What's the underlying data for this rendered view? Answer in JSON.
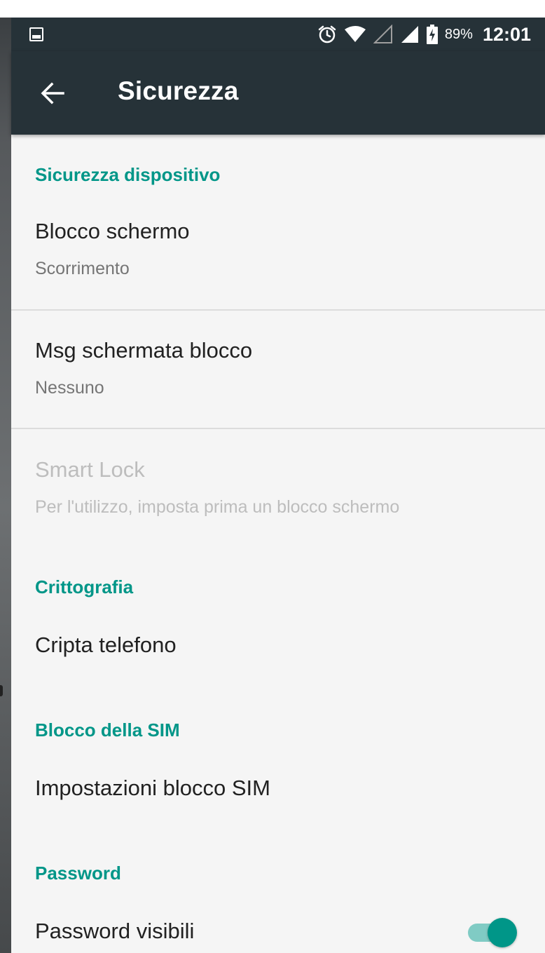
{
  "status_bar": {
    "notification_icon": "gallery-icon",
    "icons": [
      "alarm-icon",
      "wifi-icon",
      "signal-empty-icon",
      "signal-icon",
      "battery-charging-icon"
    ],
    "battery": "89%",
    "time": "12:01"
  },
  "toolbar": {
    "back_icon": "arrow-back-icon",
    "title": "Sicurezza"
  },
  "sections": {
    "device_security": {
      "header": "Sicurezza dispositivo",
      "screen_lock": {
        "title": "Blocco schermo",
        "summary": "Scorrimento"
      },
      "lock_message": {
        "title": "Msg schermata blocco",
        "summary": "Nessuno"
      },
      "smart_lock": {
        "title": "Smart Lock",
        "summary": "Per l'utilizzo, imposta prima un blocco schermo",
        "enabled": false
      }
    },
    "encryption": {
      "header": "Crittografia",
      "encrypt_phone": {
        "title": "Cripta telefono"
      }
    },
    "sim_lock": {
      "header": "Blocco della SIM",
      "sim_settings": {
        "title": "Impostazioni blocco SIM"
      }
    },
    "passwords": {
      "header": "Password",
      "show_passwords": {
        "title": "Password visibili",
        "checked": true
      }
    }
  },
  "colors": {
    "accent": "#009688",
    "toolbar": "#263238",
    "background": "#f5f5f5",
    "primary_text": "#212121",
    "secondary_text": "#757575",
    "disabled_text": "#bdbdbd"
  }
}
